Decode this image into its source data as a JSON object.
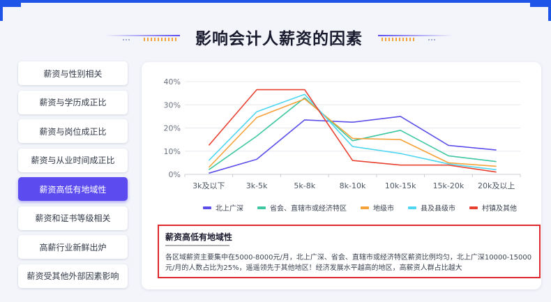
{
  "title": "影响会计人薪资的因素",
  "menu": {
    "items": [
      {
        "label": "薪资与性别相关",
        "active": false
      },
      {
        "label": "薪资与学历成正比",
        "active": false
      },
      {
        "label": "薪资与岗位成正比",
        "active": false
      },
      {
        "label": "薪资与从业时间成正比",
        "active": false
      },
      {
        "label": "薪资高低有地域性",
        "active": true
      },
      {
        "label": "薪资和证书等级相关",
        "active": false
      },
      {
        "label": "高薪行业新鲜出炉",
        "active": false
      },
      {
        "label": "薪资受其他外部因素影响",
        "active": false
      }
    ]
  },
  "chart_data": {
    "type": "line",
    "categories": [
      "3k及以下",
      "3k-5k",
      "5k-8k",
      "8k-10k",
      "10k-15k",
      "15k-20k",
      "20k及以上"
    ],
    "ylim": [
      0,
      40
    ],
    "yticks": [
      "0%",
      "10%",
      "20%",
      "30%",
      "40%"
    ],
    "grid": true,
    "legend_position": "bottom",
    "series": [
      {
        "name": "北上广深",
        "color": "#5b4ee8",
        "values": [
          0.5,
          6.5,
          23.5,
          22.5,
          25,
          12.5,
          10.5
        ]
      },
      {
        "name": "省会、直辖市或经济特区",
        "color": "#3ec7a0",
        "values": [
          2,
          16.5,
          33,
          14.5,
          19,
          8,
          5.5
        ]
      },
      {
        "name": "地级市",
        "color": "#f5a23a",
        "values": [
          3,
          24.5,
          32.5,
          15.5,
          15,
          5,
          3.5
        ]
      },
      {
        "name": "县及县级市",
        "color": "#4fd6f0",
        "values": [
          6,
          27,
          34.5,
          12,
          9,
          4.5,
          2
        ]
      },
      {
        "name": "村镇及其他",
        "color": "#e8402f",
        "values": [
          12.5,
          36.5,
          36.5,
          6,
          4,
          4,
          1
        ]
      }
    ]
  },
  "note": {
    "title": "薪资高低有地域性",
    "body": "各区域薪资主要集中在5000-8000元/月，北上广深、省会、直辖市或经济特区薪资比例均匀，北上广深10000-15000元/月的人数占比为25%，遥遥领先于其他地区！经济发展水平越高的地区，高薪资人群占比越大"
  }
}
